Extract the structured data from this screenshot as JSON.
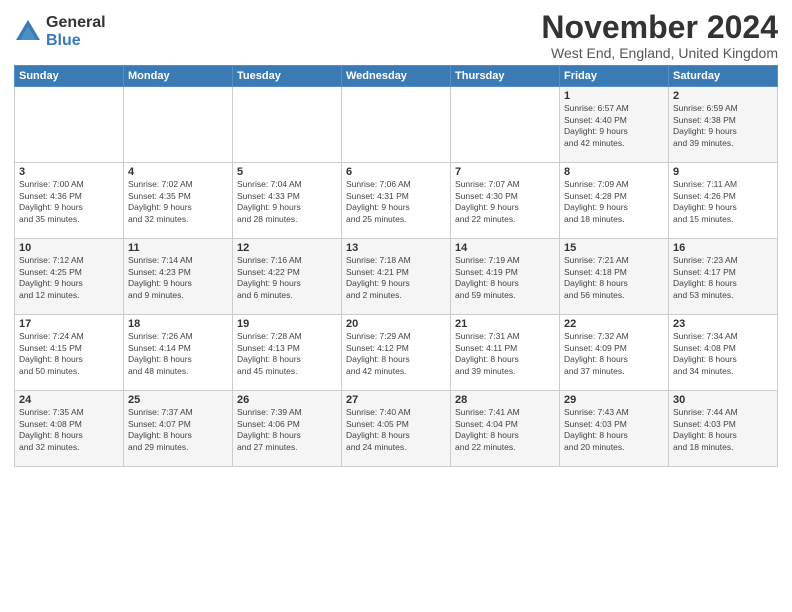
{
  "logo": {
    "general": "General",
    "blue": "Blue"
  },
  "title": "November 2024",
  "location": "West End, England, United Kingdom",
  "headers": [
    "Sunday",
    "Monday",
    "Tuesday",
    "Wednesday",
    "Thursday",
    "Friday",
    "Saturday"
  ],
  "weeks": [
    [
      {
        "day": "",
        "info": ""
      },
      {
        "day": "",
        "info": ""
      },
      {
        "day": "",
        "info": ""
      },
      {
        "day": "",
        "info": ""
      },
      {
        "day": "",
        "info": ""
      },
      {
        "day": "1",
        "info": "Sunrise: 6:57 AM\nSunset: 4:40 PM\nDaylight: 9 hours\nand 42 minutes."
      },
      {
        "day": "2",
        "info": "Sunrise: 6:59 AM\nSunset: 4:38 PM\nDaylight: 9 hours\nand 39 minutes."
      }
    ],
    [
      {
        "day": "3",
        "info": "Sunrise: 7:00 AM\nSunset: 4:36 PM\nDaylight: 9 hours\nand 35 minutes."
      },
      {
        "day": "4",
        "info": "Sunrise: 7:02 AM\nSunset: 4:35 PM\nDaylight: 9 hours\nand 32 minutes."
      },
      {
        "day": "5",
        "info": "Sunrise: 7:04 AM\nSunset: 4:33 PM\nDaylight: 9 hours\nand 28 minutes."
      },
      {
        "day": "6",
        "info": "Sunrise: 7:06 AM\nSunset: 4:31 PM\nDaylight: 9 hours\nand 25 minutes."
      },
      {
        "day": "7",
        "info": "Sunrise: 7:07 AM\nSunset: 4:30 PM\nDaylight: 9 hours\nand 22 minutes."
      },
      {
        "day": "8",
        "info": "Sunrise: 7:09 AM\nSunset: 4:28 PM\nDaylight: 9 hours\nand 18 minutes."
      },
      {
        "day": "9",
        "info": "Sunrise: 7:11 AM\nSunset: 4:26 PM\nDaylight: 9 hours\nand 15 minutes."
      }
    ],
    [
      {
        "day": "10",
        "info": "Sunrise: 7:12 AM\nSunset: 4:25 PM\nDaylight: 9 hours\nand 12 minutes."
      },
      {
        "day": "11",
        "info": "Sunrise: 7:14 AM\nSunset: 4:23 PM\nDaylight: 9 hours\nand 9 minutes."
      },
      {
        "day": "12",
        "info": "Sunrise: 7:16 AM\nSunset: 4:22 PM\nDaylight: 9 hours\nand 6 minutes."
      },
      {
        "day": "13",
        "info": "Sunrise: 7:18 AM\nSunset: 4:21 PM\nDaylight: 9 hours\nand 2 minutes."
      },
      {
        "day": "14",
        "info": "Sunrise: 7:19 AM\nSunset: 4:19 PM\nDaylight: 8 hours\nand 59 minutes."
      },
      {
        "day": "15",
        "info": "Sunrise: 7:21 AM\nSunset: 4:18 PM\nDaylight: 8 hours\nand 56 minutes."
      },
      {
        "day": "16",
        "info": "Sunrise: 7:23 AM\nSunset: 4:17 PM\nDaylight: 8 hours\nand 53 minutes."
      }
    ],
    [
      {
        "day": "17",
        "info": "Sunrise: 7:24 AM\nSunset: 4:15 PM\nDaylight: 8 hours\nand 50 minutes."
      },
      {
        "day": "18",
        "info": "Sunrise: 7:26 AM\nSunset: 4:14 PM\nDaylight: 8 hours\nand 48 minutes."
      },
      {
        "day": "19",
        "info": "Sunrise: 7:28 AM\nSunset: 4:13 PM\nDaylight: 8 hours\nand 45 minutes."
      },
      {
        "day": "20",
        "info": "Sunrise: 7:29 AM\nSunset: 4:12 PM\nDaylight: 8 hours\nand 42 minutes."
      },
      {
        "day": "21",
        "info": "Sunrise: 7:31 AM\nSunset: 4:11 PM\nDaylight: 8 hours\nand 39 minutes."
      },
      {
        "day": "22",
        "info": "Sunrise: 7:32 AM\nSunset: 4:09 PM\nDaylight: 8 hours\nand 37 minutes."
      },
      {
        "day": "23",
        "info": "Sunrise: 7:34 AM\nSunset: 4:08 PM\nDaylight: 8 hours\nand 34 minutes."
      }
    ],
    [
      {
        "day": "24",
        "info": "Sunrise: 7:35 AM\nSunset: 4:08 PM\nDaylight: 8 hours\nand 32 minutes."
      },
      {
        "day": "25",
        "info": "Sunrise: 7:37 AM\nSunset: 4:07 PM\nDaylight: 8 hours\nand 29 minutes."
      },
      {
        "day": "26",
        "info": "Sunrise: 7:39 AM\nSunset: 4:06 PM\nDaylight: 8 hours\nand 27 minutes."
      },
      {
        "day": "27",
        "info": "Sunrise: 7:40 AM\nSunset: 4:05 PM\nDaylight: 8 hours\nand 24 minutes."
      },
      {
        "day": "28",
        "info": "Sunrise: 7:41 AM\nSunset: 4:04 PM\nDaylight: 8 hours\nand 22 minutes."
      },
      {
        "day": "29",
        "info": "Sunrise: 7:43 AM\nSunset: 4:03 PM\nDaylight: 8 hours\nand 20 minutes."
      },
      {
        "day": "30",
        "info": "Sunrise: 7:44 AM\nSunset: 4:03 PM\nDaylight: 8 hours\nand 18 minutes."
      }
    ]
  ]
}
